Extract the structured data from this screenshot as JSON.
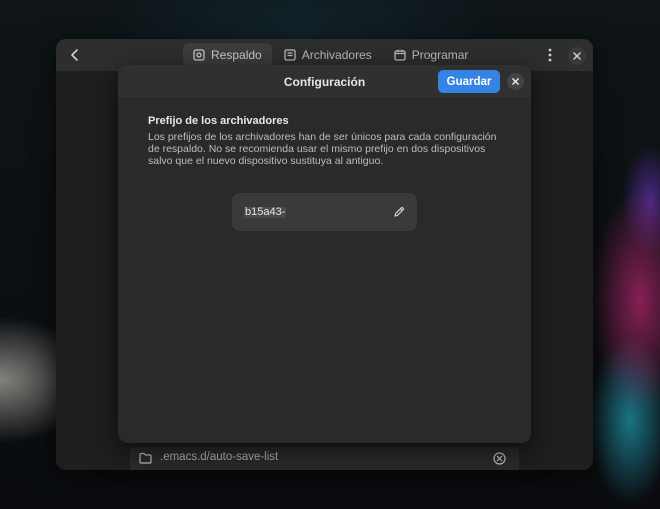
{
  "window": {
    "tabs": [
      {
        "label": "Respaldo",
        "icon": "backup-icon",
        "active": true
      },
      {
        "label": "Archivadores",
        "icon": "archive-icon",
        "active": false
      },
      {
        "label": "Programar",
        "icon": "calendar-icon",
        "active": false
      }
    ],
    "folder_path": ".emacs.d/auto-save-list"
  },
  "dialog": {
    "title": "Configuración",
    "save_label": "Guardar",
    "section_title": "Prefijo de los archivadores",
    "section_description": "Los prefijos de los archivadores han de ser únicos para cada configuración de respaldo. No se recomienda usar el mismo prefijo en dos dispositivos salvo que el nuevo dispositivo sustituya al antiguo.",
    "prefix_value": "b15a43-"
  },
  "colors": {
    "accent": "#3584e4",
    "window_bg": "#242424",
    "dialog_bg": "#2a2a2a"
  }
}
